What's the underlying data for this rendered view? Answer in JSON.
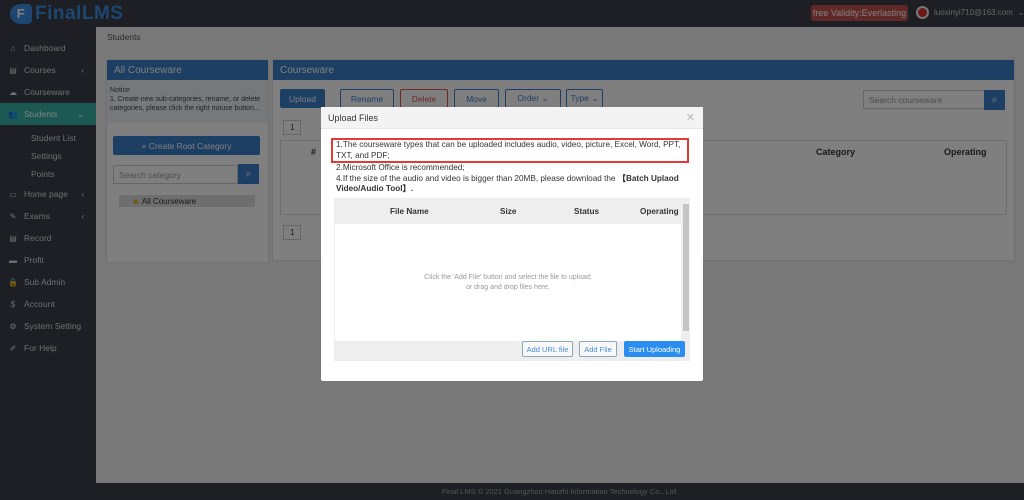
{
  "header": {
    "logo_text": "FinalLMS",
    "logo_letter": "F",
    "validity": "free Validity:Everlasting",
    "user": "luoxinyi710@163.com"
  },
  "sidebar": {
    "items": [
      {
        "label": "Dashboard",
        "icon": "⌂"
      },
      {
        "label": "Courses",
        "icon": "▤",
        "chevron": "‹"
      },
      {
        "label": "Courseware",
        "icon": "☁"
      },
      {
        "label": "Students",
        "icon": "👥",
        "chevron": "⌄"
      },
      {
        "label": "Home page",
        "icon": "▭",
        "chevron": "‹"
      },
      {
        "label": "Exams",
        "icon": "✎",
        "chevron": "‹"
      },
      {
        "label": "Record",
        "icon": "▤"
      },
      {
        "label": "Profit",
        "icon": "▬"
      },
      {
        "label": "Sub Admin",
        "icon": "🔒"
      },
      {
        "label": "Account",
        "icon": "$"
      },
      {
        "label": "System Setting",
        "icon": "⚙"
      },
      {
        "label": "For Help",
        "icon": "✐"
      }
    ],
    "sub_items": [
      "Student List",
      "Settings",
      "Points"
    ]
  },
  "breadcrumb": "Students",
  "left_panel": {
    "title": "All Courseware",
    "notice_title": "Notice",
    "notice": "1. Create new sub-categories, rename, or delete categories, please click the right mouse button...",
    "create_button": "+ Create Root Category",
    "search_placeholder": "Search category",
    "tree_root": "All Courseware"
  },
  "right_panel": {
    "title": "Courseware",
    "toolbar": [
      "Upload",
      "Rename",
      "Delete",
      "Move",
      "Order ⌄",
      "Type ⌄"
    ],
    "search_placeholder": "Search courseware",
    "columns": [
      "#",
      "Category",
      "Operating"
    ],
    "page": "1"
  },
  "modal": {
    "title": "Upload Files",
    "notes": [
      "1.The courseware types that can be uploaded includes audio, video, picture, Excel, Word, PPT, TXT, and PDF;",
      "2.Microsoft Office is recommended;",
      "4.If the size of the audio and video is bigger than 20MB, please download the "
    ],
    "tool_link": "【Batch Uplaod Video/Audio Tool】.",
    "columns": [
      "File Name",
      "Size",
      "Status",
      "Operating"
    ],
    "empty_line1": "Click the 'Add File' button and select the file to upload;",
    "empty_line2": "or drag and drop files here.",
    "add_url": "Add URL file",
    "add_file": "Add File",
    "start": "Start Uploading"
  },
  "footer": "Final LMS © 2021 Guangzhou Haozhi Information Technology Co., Ltd."
}
